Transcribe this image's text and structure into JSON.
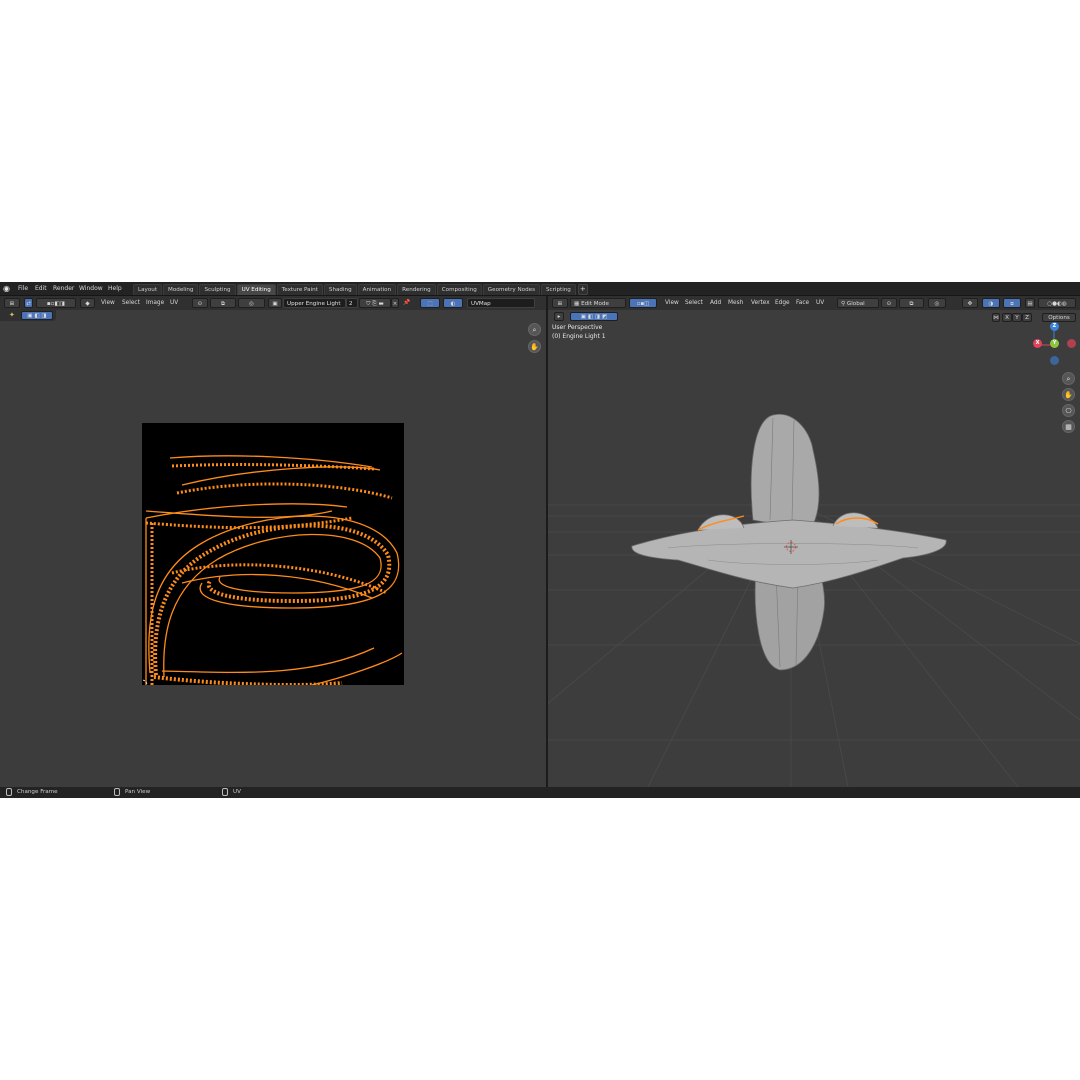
{
  "topbar": {
    "menus": [
      "File",
      "Edit",
      "Render",
      "Window",
      "Help"
    ],
    "workspaces": [
      "Layout",
      "Modeling",
      "Sculpting",
      "UV Editing",
      "Texture Paint",
      "Shading",
      "Animation",
      "Rendering",
      "Compositing",
      "Geometry Nodes",
      "Scripting"
    ],
    "active_workspace": "UV Editing",
    "add_label": "+"
  },
  "uv_editor": {
    "menus": [
      "View",
      "Select",
      "Image",
      "UV"
    ],
    "image_name": "Upper Engine Light",
    "image_users": "2",
    "uvmap_name": "UVMap"
  },
  "viewport": {
    "mode": "Edit Mode",
    "menus": [
      "View",
      "Select",
      "Add",
      "Mesh",
      "Vertex",
      "Edge",
      "Face",
      "UV"
    ],
    "transform_orientation": "Global",
    "axes": [
      "X",
      "Y",
      "Z"
    ],
    "options_label": "Options",
    "view_name": "User Perspective",
    "object_name": "(0) Engine Light 1",
    "gizmo": {
      "x": "X",
      "y": "Y",
      "z": "Z"
    }
  },
  "statusbar": {
    "left": "Change Frame",
    "middle": "Pan View",
    "right": "UV"
  },
  "colors": {
    "uv_edge": "#ff8c1a",
    "select_blue": "#4a73b8",
    "axis_x": "#e0435a",
    "axis_y": "#8cc63f",
    "axis_z": "#3b82d8"
  }
}
